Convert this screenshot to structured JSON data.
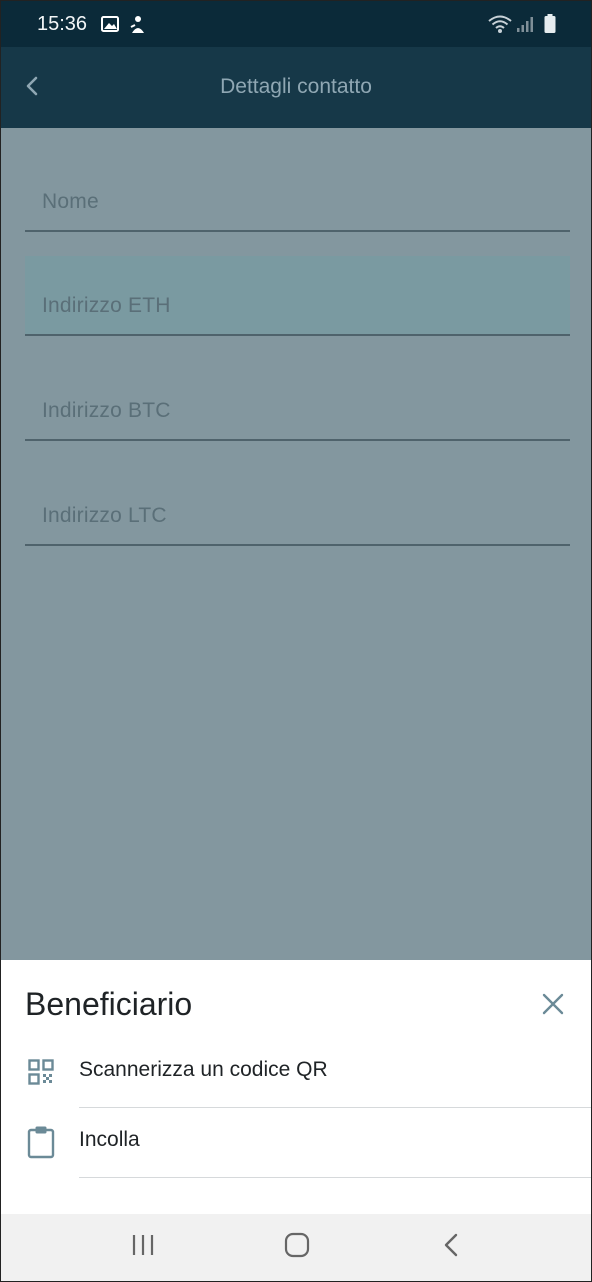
{
  "status_bar": {
    "time": "15:36",
    "left_icons": [
      "image-icon",
      "notification-icon"
    ],
    "right_icons": [
      "wifi-icon",
      "signal-icon",
      "battery-icon"
    ]
  },
  "app_bar": {
    "title": "Dettagli contatto",
    "back_icon": "chevron-left-icon"
  },
  "form": {
    "fields": [
      {
        "label": "Nome",
        "value": ""
      },
      {
        "label": "Indirizzo ETH",
        "value": ""
      },
      {
        "label": "Indirizzo BTC",
        "value": ""
      },
      {
        "label": "Indirizzo LTC",
        "value": ""
      }
    ]
  },
  "sheet": {
    "title": "Beneficiario",
    "close_icon": "close-icon",
    "options": [
      {
        "label": "Scannerizza un codice QR",
        "icon": "qr-code-icon"
      },
      {
        "label": "Incolla",
        "icon": "clipboard-icon"
      }
    ]
  },
  "nav_bar": {
    "buttons": [
      "recent-apps-icon",
      "home-icon",
      "back-icon"
    ]
  },
  "colors": {
    "status_bar": "#0b2a39",
    "app_bar": "#163848",
    "overlay": "#83979f",
    "highlight_field": "#7a9aa1",
    "accent_icon": "#6b8a97"
  }
}
